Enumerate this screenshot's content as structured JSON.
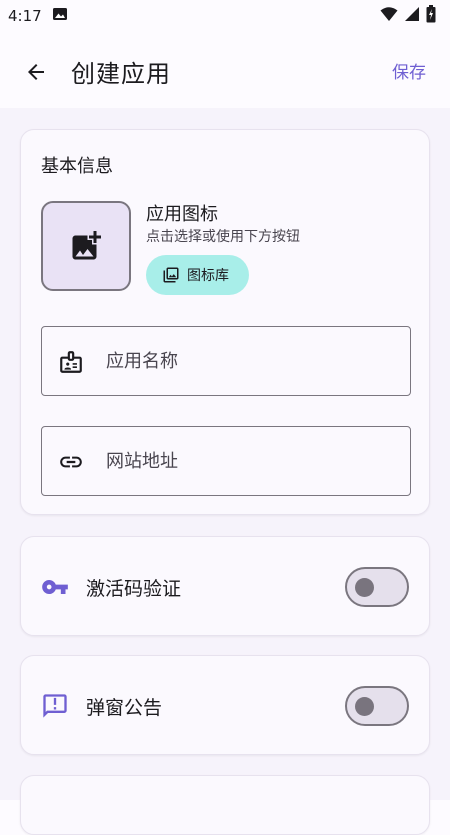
{
  "status_bar": {
    "time": "4:17"
  },
  "app_bar": {
    "title": "创建应用",
    "save_label": "保存"
  },
  "basic_info": {
    "section_title": "基本信息",
    "icon_label": "应用图标",
    "icon_hint": "点击选择或使用下方按钮",
    "icon_library_label": "图标库",
    "name_field": {
      "placeholder": "应用名称",
      "value": ""
    },
    "url_field": {
      "placeholder": "网站地址",
      "value": ""
    }
  },
  "toggles": [
    {
      "label": "激活码验证",
      "icon": "key-icon",
      "enabled": false
    },
    {
      "label": "弹窗公告",
      "icon": "announcement-icon",
      "enabled": false
    }
  ],
  "colors": {
    "accent": "#6f5fd2",
    "icon_library_bg": "#a8eee9",
    "icon_picker_bg": "#e9e2f5"
  }
}
